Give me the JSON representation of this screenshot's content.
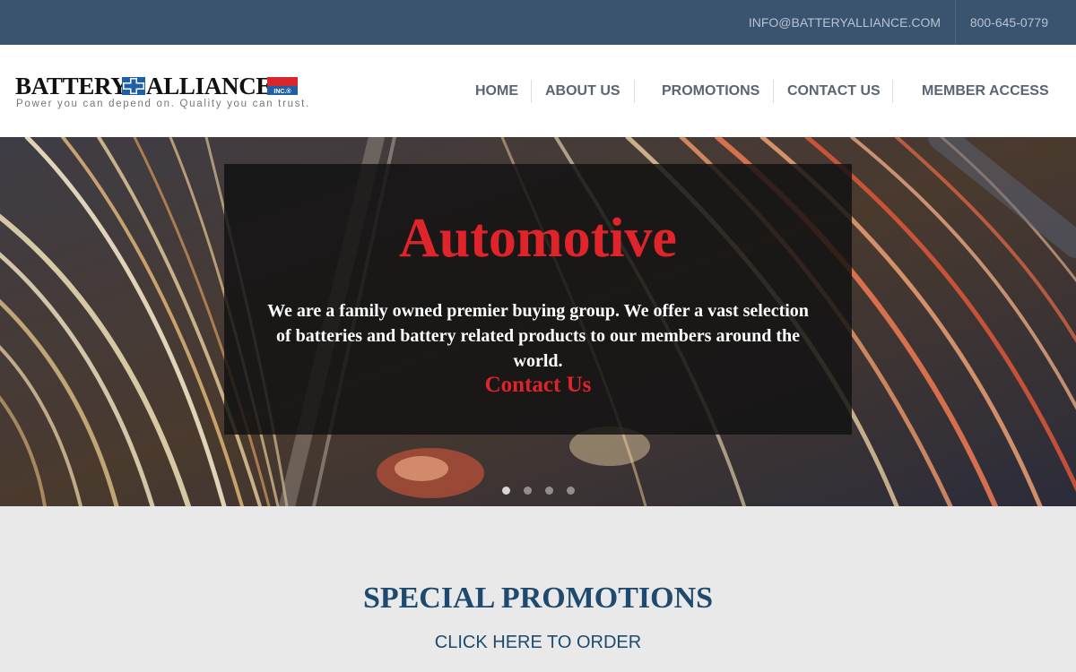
{
  "topbar": {
    "email": "INFO@BATTERYALLIANCE.COM",
    "phone": "800-645-0779"
  },
  "logo": {
    "word1": "BATTERY",
    "word2": "ALLIANCE",
    "badge": "INC.®",
    "tagline": "Power you can depend on. Quality you can trust."
  },
  "nav": {
    "items": [
      {
        "label": "HOME"
      },
      {
        "label": "ABOUT US"
      },
      {
        "label": "PROMOTIONS"
      },
      {
        "label": "CONTACT US"
      },
      {
        "label": "MEMBER ACCESS"
      }
    ]
  },
  "hero": {
    "title": "Automotive",
    "description": "We are a family owned premier buying group. We offer a vast selection of batteries and battery related products to our members around the world.",
    "cta": "Contact Us",
    "slide_count": 4,
    "active_slide": 1
  },
  "promotions": {
    "heading": "SPECIAL PROMOTIONS",
    "link": "CLICK HERE TO ORDER"
  },
  "colors": {
    "topbar": "#3a536e",
    "accent_red": "#e0242b",
    "heading_blue": "#1d4a6e",
    "promo_bg": "#e9e9e9"
  }
}
